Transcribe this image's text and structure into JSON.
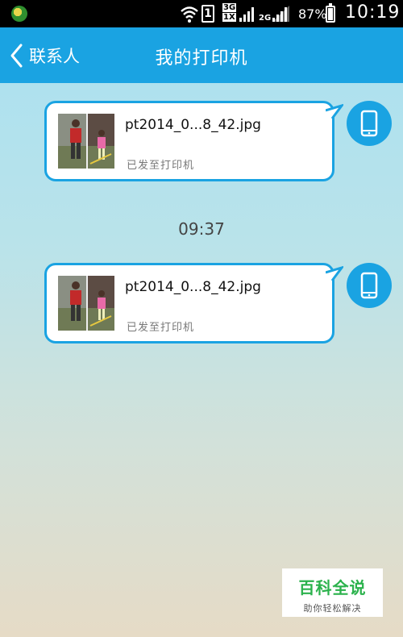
{
  "status_bar": {
    "sim_slot": "1",
    "net_3g": "3G",
    "net_1x": "1X",
    "net_2g": "2G",
    "battery": "87%",
    "time": "10:19"
  },
  "header": {
    "back_label": "联系人",
    "title": "我的打印机",
    "bg_color": "#1aa3e2"
  },
  "messages": [
    {
      "file_name": "pt2014_0...8_42.jpg",
      "status": "已发至打印机"
    },
    {
      "file_name": "pt2014_0...8_42.jpg",
      "status": "已发至打印机"
    }
  ],
  "timestamp": "09:37",
  "watermark": {
    "logo": "百科全说",
    "tagline": "助你轻松解决"
  }
}
